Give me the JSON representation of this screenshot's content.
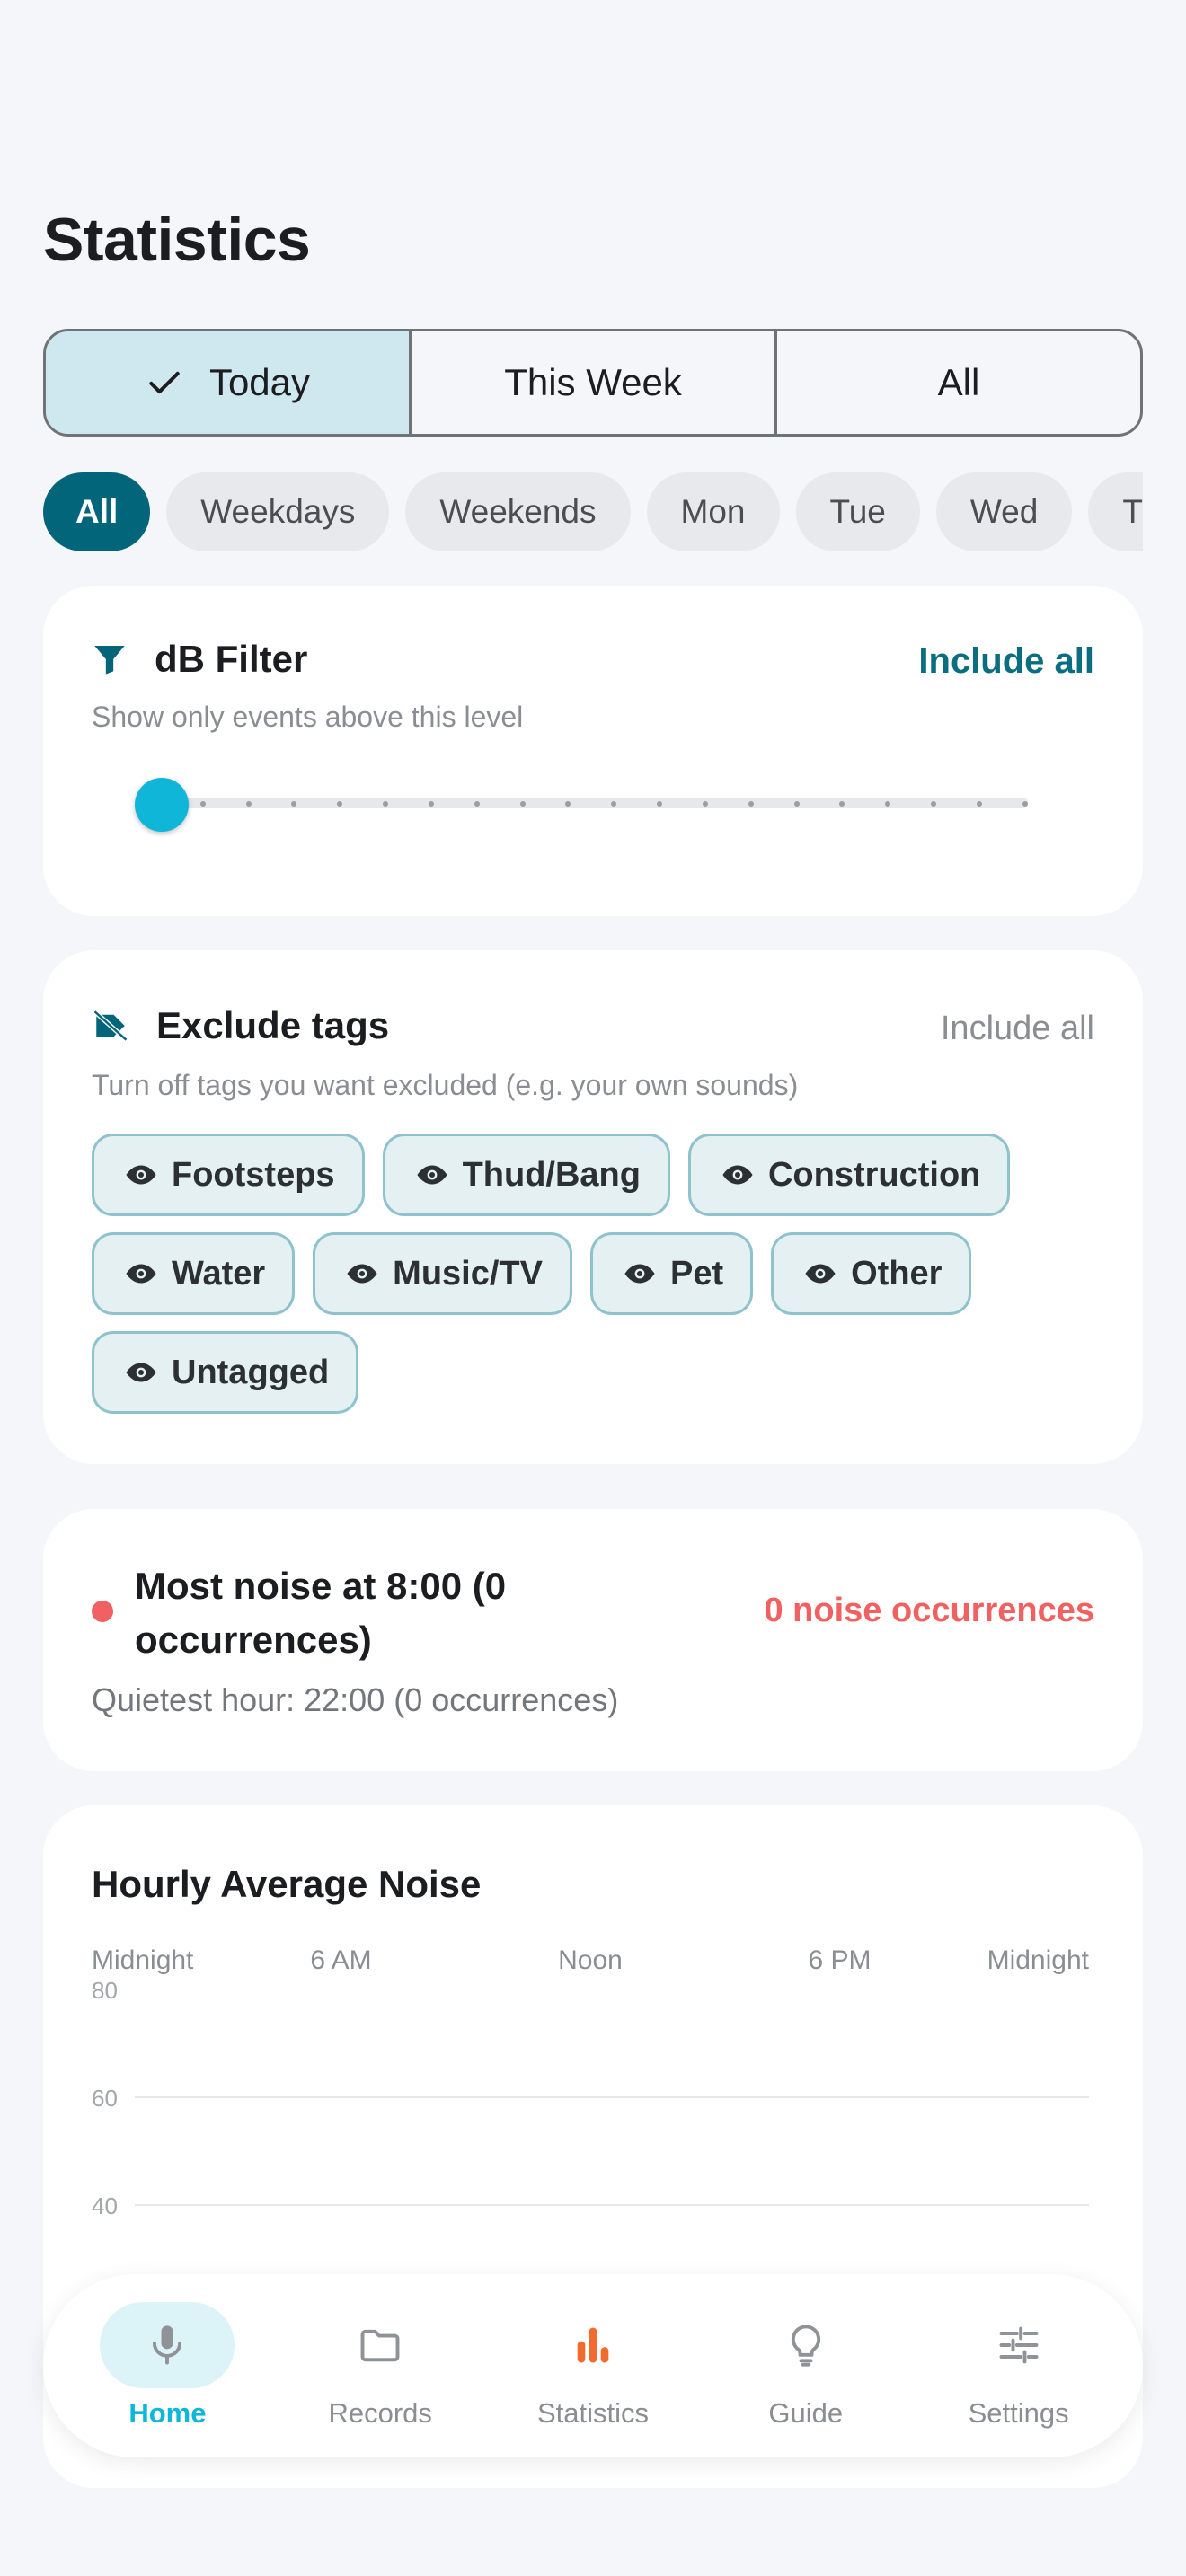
{
  "title": "Statistics",
  "segments": [
    {
      "label": "Today",
      "active": true
    },
    {
      "label": "This Week",
      "active": false
    },
    {
      "label": "All",
      "active": false
    }
  ],
  "day_filters": [
    "All",
    "Weekdays",
    "Weekends",
    "Mon",
    "Tue",
    "Wed",
    "Thu"
  ],
  "db_filter": {
    "title": "dB Filter",
    "action": "Include all",
    "subtitle": "Show only events above this level",
    "level": 0
  },
  "exclude_tags": {
    "title": "Exclude tags",
    "action": "Include all",
    "subtitle": "Turn off tags you want excluded (e.g. your own sounds)",
    "tags": [
      "Footsteps",
      "Thud/Bang",
      "Construction",
      "Water",
      "Music/TV",
      "Pet",
      "Other",
      "Untagged"
    ]
  },
  "summary": {
    "title": "Most noise at 8:00 (0 occurrences)",
    "count": "0 noise occurrences",
    "quietest": "Quietest hour: 22:00 (0 occurrences)"
  },
  "chart_data": {
    "type": "line",
    "title": "Hourly Average Noise",
    "x_tick_labels": [
      "Midnight",
      "6 AM",
      "Noon",
      "6 PM",
      "Midnight"
    ],
    "y_ticks": [
      80,
      60,
      40
    ],
    "series": [],
    "grid": true
  },
  "nav": [
    {
      "label": "Home",
      "icon": "microphone-icon",
      "active": true
    },
    {
      "label": "Records",
      "icon": "folder-icon",
      "active": false
    },
    {
      "label": "Statistics",
      "icon": "bar-chart-icon",
      "active": false
    },
    {
      "label": "Guide",
      "icon": "lightbulb-icon",
      "active": false
    },
    {
      "label": "Settings",
      "icon": "sliders-icon",
      "active": false
    }
  ],
  "colors": {
    "accent": "#0fb6d8",
    "teal": "#03657a",
    "alert": "#f16161",
    "stats_icon": "#f26b2e"
  }
}
